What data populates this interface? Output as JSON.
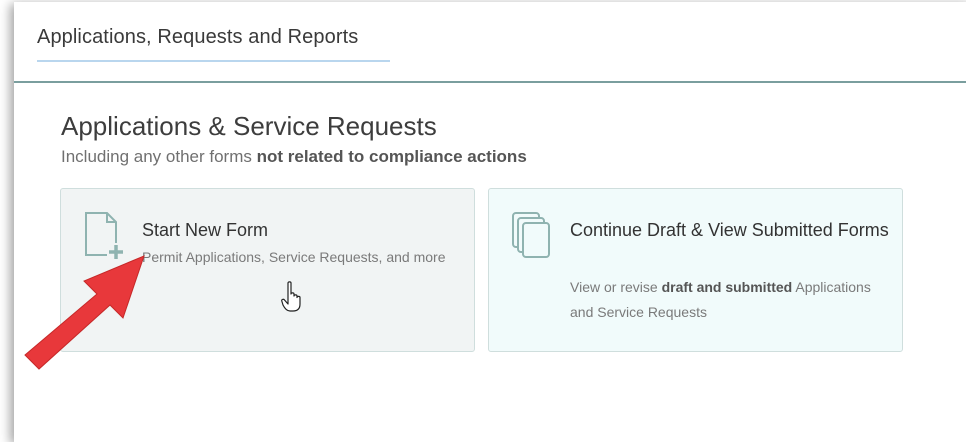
{
  "header": {
    "tab_label": "Applications, Requests and Reports"
  },
  "section": {
    "title": "Applications & Service Requests",
    "subtitle_prefix": "Including any other forms ",
    "subtitle_bold": "not related to compliance actions"
  },
  "cards": [
    {
      "title": "Start New Form",
      "desc_prefix": "Permit Applications, Service Requests, and more",
      "desc_bold": "",
      "desc_suffix": "",
      "icon": "new-document-icon"
    },
    {
      "title": "Continue Draft & View Submitted Forms",
      "desc_prefix": "View or revise ",
      "desc_bold": "draft and submitted",
      "desc_suffix": " Applications and Service Requests",
      "icon": "stacked-documents-icon"
    }
  ],
  "colors": {
    "accent": "#7a9e9e",
    "arrow": "#e8383b",
    "card_bg_1": "#f1f4f4",
    "card_bg_2": "#f1fbfb"
  }
}
